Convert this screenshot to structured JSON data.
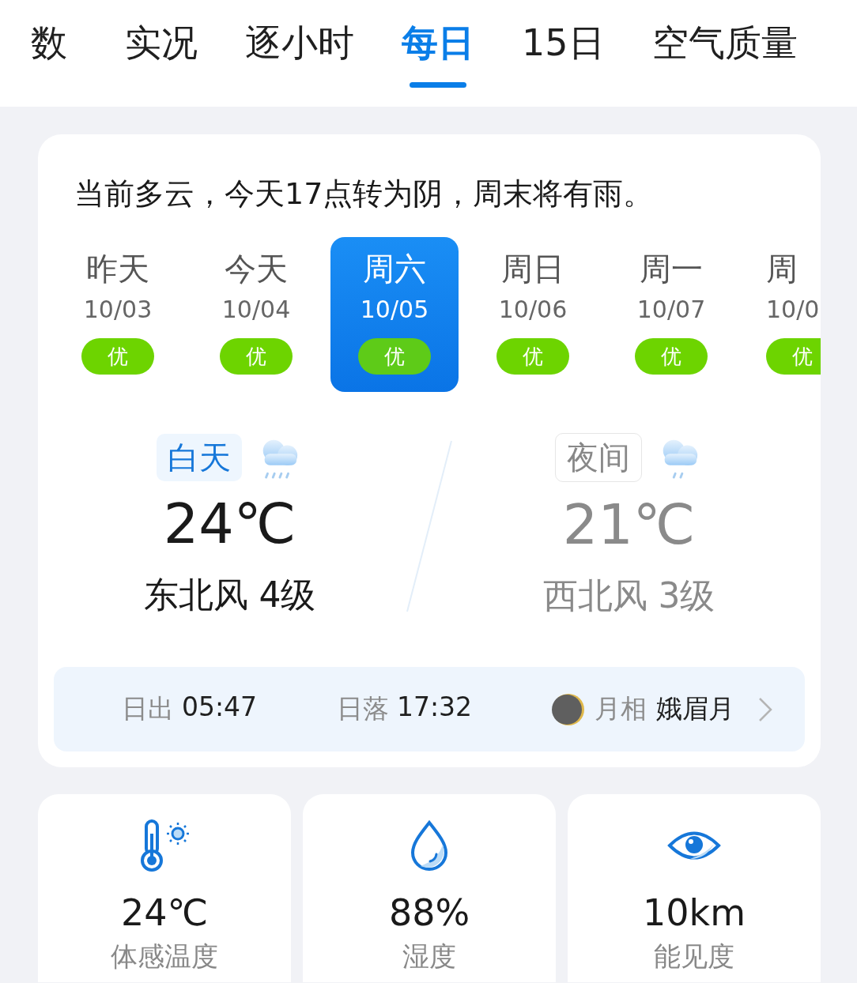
{
  "tabs": [
    {
      "label": "数",
      "selected": false
    },
    {
      "label": "实况",
      "selected": false
    },
    {
      "label": "逐小时",
      "selected": false
    },
    {
      "label": "每日",
      "selected": true
    },
    {
      "label": "15日",
      "selected": false
    },
    {
      "label": "空气质量",
      "selected": false
    }
  ],
  "summary": "当前多云，今天17点转为阴，周末将有雨。",
  "days": [
    {
      "weekday": "昨天",
      "date": "10/03",
      "aqi": "优",
      "selected": false
    },
    {
      "weekday": "今天",
      "date": "10/04",
      "aqi": "优",
      "selected": false
    },
    {
      "weekday": "周六",
      "date": "10/05",
      "aqi": "优",
      "selected": true
    },
    {
      "weekday": "周日",
      "date": "10/06",
      "aqi": "优",
      "selected": false
    },
    {
      "weekday": "周一",
      "date": "10/07",
      "aqi": "优",
      "selected": false
    },
    {
      "weekday": "周",
      "date": "10/0",
      "aqi": "优",
      "selected": false
    }
  ],
  "periods": [
    {
      "kind": "day",
      "label": "白天",
      "temp": "24℃",
      "wind": "东北风 4级"
    },
    {
      "kind": "night",
      "label": "夜间",
      "temp": "21℃",
      "wind": "西北风 3级"
    }
  ],
  "sun": [
    {
      "label": "日出",
      "value": "05:47"
    },
    {
      "label": "日落",
      "value": "17:32"
    }
  ],
  "moon": {
    "label": "月相",
    "value": "娥眉月"
  },
  "details": [
    {
      "kind": "feels",
      "value": "24℃",
      "label": "体感温度"
    },
    {
      "kind": "humidity",
      "value": "88%",
      "label": "湿度"
    },
    {
      "kind": "visibility",
      "value": "10km",
      "label": "能见度"
    }
  ]
}
